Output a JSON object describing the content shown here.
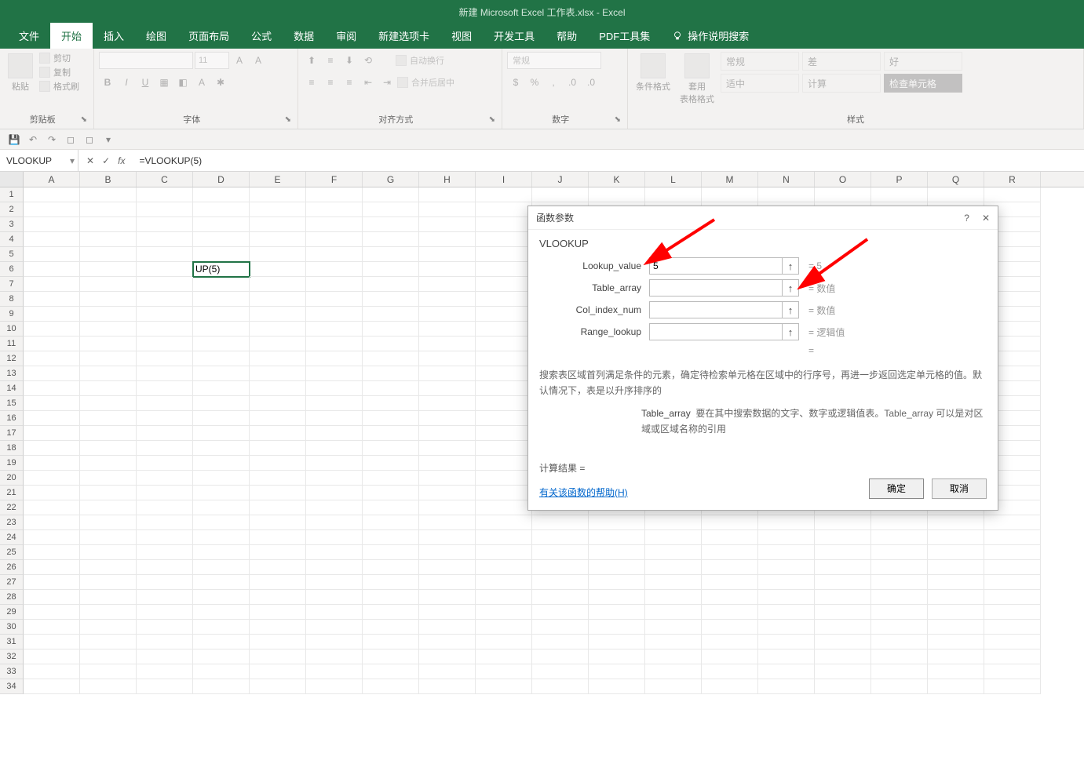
{
  "title": "新建 Microsoft Excel 工作表.xlsx - Excel",
  "tabs": {
    "file": "文件",
    "home": "开始",
    "insert": "插入",
    "draw": "绘图",
    "pagelayout": "页面布局",
    "formulas": "公式",
    "data": "数据",
    "review": "审阅",
    "newtab": "新建选项卡",
    "view": "视图",
    "dev": "开发工具",
    "help": "帮助",
    "pdf": "PDF工具集",
    "tell": "操作说明搜索"
  },
  "ribbon": {
    "clipboard": {
      "label": "剪贴板",
      "paste": "粘贴",
      "cut": "剪切",
      "copy": "复制",
      "painter": "格式刷"
    },
    "font": {
      "label": "字体",
      "size": "11"
    },
    "align": {
      "label": "对齐方式",
      "wrap": "自动换行",
      "merge": "合并后居中"
    },
    "number": {
      "label": "数字",
      "general": "常规"
    },
    "styles": {
      "label": "样式",
      "condfmt": "条件格式",
      "tablefmt": "套用\n表格格式",
      "cells": {
        "normal": "常规",
        "bad": "差",
        "good": "好",
        "fit": "适中",
        "calc": "计算",
        "check": "检查单元格"
      }
    }
  },
  "formula_bar": {
    "name_box": "VLOOKUP",
    "formula": "=VLOOKUP(5)"
  },
  "grid": {
    "columns": [
      "A",
      "B",
      "C",
      "D",
      "E",
      "F",
      "G",
      "H",
      "I",
      "J",
      "K",
      "L",
      "M",
      "N",
      "O",
      "P",
      "Q",
      "R"
    ],
    "active_cell_content": "UP(5)",
    "row_count": 34
  },
  "dialog": {
    "title": "函数参数",
    "fn": "VLOOKUP",
    "args": {
      "lookup_value": {
        "label": "Lookup_value",
        "value": "5",
        "result": "= 5"
      },
      "table_array": {
        "label": "Table_array",
        "value": "",
        "result": "= 数值"
      },
      "col_index_num": {
        "label": "Col_index_num",
        "value": "",
        "result": "= 数值"
      },
      "range_lookup": {
        "label": "Range_lookup",
        "value": "",
        "result": "= 逻辑值"
      }
    },
    "eq_alone": "=",
    "desc1": "搜索表区域首列满足条件的元素，确定待检索单元格在区域中的行序号，再进一步返回选定单元格的值。默认情况下，表是以升序排序的",
    "desc2_label": "Table_array",
    "desc2_text": "要在其中搜索数据的文字、数字或逻辑值表。Table_array 可以是对区域或区域名称的引用",
    "result": "计算结果 =",
    "help": "有关该函数的帮助(H)",
    "ok": "确定",
    "cancel": "取消"
  }
}
